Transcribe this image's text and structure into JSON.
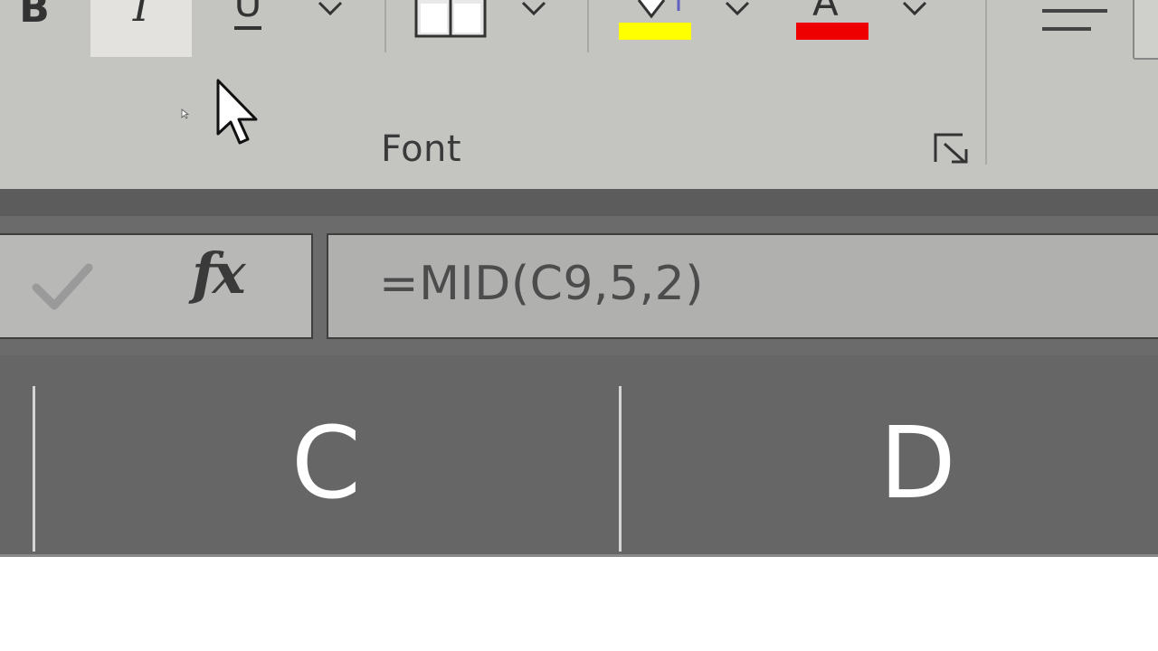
{
  "ribbon": {
    "font_group": {
      "label": "Font",
      "bold_glyph": "B",
      "italic_glyph": "I",
      "underline_glyph": "U",
      "font_color_glyph": "A",
      "highlight_color": "#ffff00",
      "font_color": "#ee0000",
      "italic_active": true
    },
    "icons": {
      "bold": "bold-icon",
      "italic": "italic-icon",
      "underline": "underline-icon",
      "borders": "borders-icon",
      "fill_color": "fill-color-icon",
      "font_color": "font-color-icon",
      "align": "align-left-icon",
      "launcher": "dialog-launcher-icon"
    }
  },
  "formula_bar": {
    "enter_icon": "checkmark-icon",
    "fx_label": "fx",
    "formula": "=MID(C9,5,2)"
  },
  "columns": [
    {
      "letter": "C"
    },
    {
      "letter": "D"
    }
  ]
}
